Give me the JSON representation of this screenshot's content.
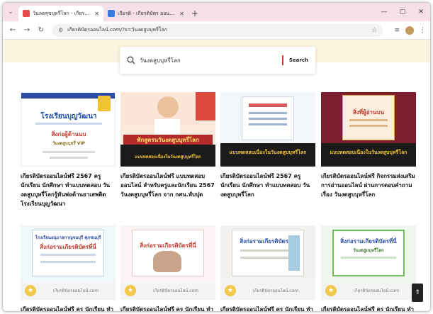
{
  "browser": {
    "tabs": [
      {
        "title": "วันลดสุขบุหรี่โลก - เกียรติบัตรออนไล",
        "active": true
      },
      {
        "title": "เกียรติ - เกียรติบัตร ออนไลน์ ฟรี ใน",
        "active": false
      }
    ],
    "url": "เกียรติบัตรออนไลน์.com/?s=วันงดสูบบุหรี่โลก",
    "window_controls": [
      "—",
      "▢",
      "✕"
    ]
  },
  "search": {
    "query": "วันงดสูบบุหรี่โลก",
    "button_label": "Search"
  },
  "cards": [
    {
      "caption": "เกียรติบัตรออนไลน์ฟรี 2567 ครู นักเรียน นักศึกษา ทำแบบทดสอบ วันงดสูบบุหรี่โลกรู้ทันพ่อต้านยาเสพติด โรงเรียนบุญวัฒนา",
      "thumb_lines": [
        "โรงเรียนบุญวัฒนา",
        "สิ่งก่อผู้ต้านนบ",
        "วันงดสูบบุหรี่ VIP"
      ]
    },
    {
      "caption": "เกียรติบัตรออนไลน์ฟรี แบบทดสอบออนไลน์ สำหรับครูและนักเรียน 2567 วันงดสูบบุหรี่โลก จาก กศน.ทับปุด",
      "thumb_lines": [
        "พักสูตรนวันงดสูบบุหรี่โลก",
        "แบบทดสอบเนื่องในวันงดสูบบุหรี่โลก"
      ]
    },
    {
      "caption": "เกียรติบัตรออนไลน์ฟรี 2567 ครู นักเรียน นักศึกษา ทำแบบทดสอบ วันงดสูบบุหรี่โลก",
      "thumb_lines": [
        "แบบทดสอบเนื่องในวันงดสูบบุหรี่โลก"
      ]
    },
    {
      "caption": "เกียรติบัตรออนไลน์ฟรี กิจกรรมส่งเสริมการอ่านออนไลน์ ผ่านการตอบคำถาม เรื่อง วันงดสูบบุหรี่โลก",
      "thumb_lines": [
        "สิ่งที่ผู้อ่านบน",
        "แบบทดสอบเนื่องในวันงดสูบบุหรี่โลก"
      ]
    },
    {
      "caption": "เกียรติบัตรออนไลน์ฟรี ครู นักเรียน ทำ",
      "thumb_lines": [
        "โรงเรียนอนุบาลกาญจนบุรี ศุภชนบุรี",
        "สิ่งก่อรามเกียรติบัตรที่นี่"
      ],
      "site": "เกียรติบัตรออนไลน์.com"
    },
    {
      "caption": "เกียรติบัตรออนไลน์ฟรี ครู นักเรียน ทำ",
      "thumb_lines": [
        "สิ่งก่อรามเกียรติบัตรที่นี่"
      ],
      "site": "เกียรติบัตรออนไลน์.com"
    },
    {
      "caption": "เกียรติบัตรออนไลน์ฟรี ครู นักเรียน ทำ",
      "thumb_lines": [
        "สิ่งก่อรามเกียรติบัตรที่นี่"
      ],
      "site": "เกียรติบัตรออนไลน์.com"
    },
    {
      "caption": "เกียรติบัตรออนไลน์ฟรี ครู นักเรียน ทำ",
      "thumb_lines": [
        "สิ่งก่อรามเกียรติบัตรที่นี่",
        "วันงดสูบบุหรี่โลก"
      ],
      "site": "เกียรติบัตรออนไลน์.com"
    }
  ],
  "colors": {
    "tabstrip": "#f5e0ea",
    "banner": "#fdf4e0",
    "accent_red": "#d33333"
  }
}
